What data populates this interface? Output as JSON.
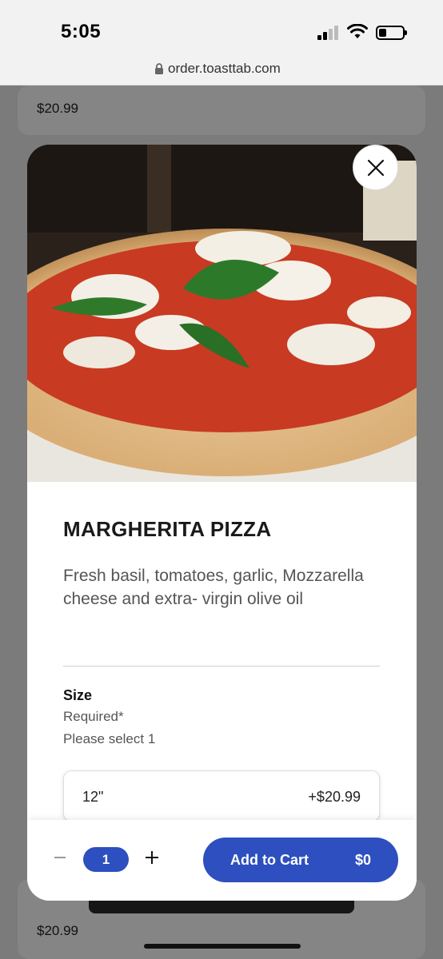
{
  "status_bar": {
    "time": "5:05"
  },
  "browser": {
    "url": "order.toasttab.com"
  },
  "background": {
    "top_price": "$20.99",
    "bottom_price": "$20.99"
  },
  "item": {
    "name": "MARGHERITA PIZZA",
    "description": "Fresh basil, tomatoes, garlic, Mozzarella cheese and extra- virgin olive oil",
    "image_icon": "pizza-photo"
  },
  "modifier": {
    "group_name": "Size",
    "required_text": "Required*",
    "hint": "Please select 1",
    "options": [
      {
        "label": "12\"",
        "price": "+$20.99"
      }
    ]
  },
  "cart": {
    "quantity": "1",
    "minus_icon": "minus-icon",
    "plus_icon": "plus-icon",
    "add_label": "Add to Cart",
    "add_price": "$0"
  },
  "colors": {
    "accent": "#2d4fbf",
    "overlay": "#7b7b7b"
  }
}
